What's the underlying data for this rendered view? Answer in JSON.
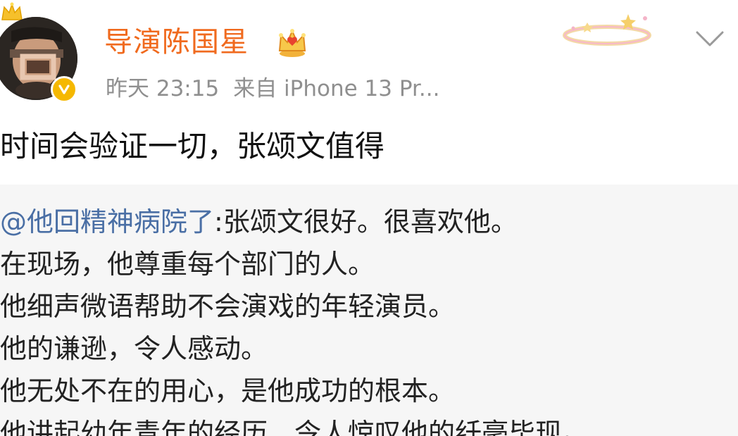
{
  "post": {
    "author": "导演陈国星",
    "time": "昨天 23:15",
    "source": "来自 iPhone 13 Pr...",
    "text": "时间会验证一切，张颂文值得"
  },
  "retweet": {
    "mention": "@他回精神病院了",
    "first_line": ":张颂文很好。很喜欢他。",
    "lines": [
      "在现场，他尊重每个部门的人。",
      "他细声微语帮助不会演戏的年轻演员。",
      "他的谦逊，令人感动。",
      "他无处不在的用心，是他成功的根本。",
      "他讲起幼年青年的经历，令人惊叹他的纤毫毕现。"
    ]
  },
  "colors": {
    "username": "#f06a1e",
    "meta": "#8f8f8f",
    "mention": "#4a6fa5",
    "verified_badge": "#f5b800",
    "retweet_bg": "#f6f6f6"
  },
  "icons": {
    "avatar": "avatar-photo",
    "vip": "crown-icon",
    "verified": "verified-badge-icon",
    "member": "member-crown-icon",
    "decoration": "card-decoration-icon",
    "more": "chevron-down-icon"
  }
}
